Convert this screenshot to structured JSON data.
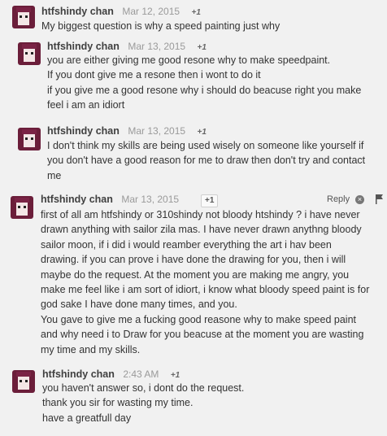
{
  "comments": [
    {
      "author": "htfshindy chan",
      "date": "Mar 12, 2015",
      "plus": "+1",
      "lines": [
        "My biggest question is why a speed painting just why"
      ]
    },
    {
      "author": "htfshindy chan",
      "date": "Mar 13, 2015",
      "plus": "+1",
      "lines": [
        "you are either giving me good resone why to make speedpaint.",
        "If you dont give me a resone then i wont to do it",
        "if you give me a good resone why i should do beacuse right you make",
        "feel i am an idiort"
      ]
    },
    {
      "author": "htfshindy chan",
      "date": "Mar 13, 2015",
      "plus": "+1",
      "lines": [
        "I don't think my skills are being used wisely on someone like yourself if",
        "you don't have a good reason for me to draw then don't try and contact",
        "me"
      ]
    },
    {
      "author": "htfshindy chan",
      "date": "Mar 13, 2015",
      "plus": "+1",
      "reply_label": "Reply",
      "lines": [
        "first of all  am htfshindy or 310shindy not bloody htshindy ? i have never",
        "drawn anything with sailor zila mas. I have never drawn anythng bloody",
        "sailor moon, if i did i would reamber everything  the art i hav been",
        "drawing. if you can prove i have done the  drawing for you, then i will",
        "maybe do the request. At the moment you are making me  angry, you",
        "make me feel like i am sort of idiort, i know what bloody speed paint is for",
        "god sake I have done many times, and you.",
        "You gave to give me a fucking good reasone why to make speed paint",
        "and why need i to Draw for you beacuse at the moment you are wasting",
        "my time and my skills."
      ]
    },
    {
      "author": "htfshindy chan",
      "date": "2:43 AM",
      "plus": "+1",
      "lines": [
        "you haven't answer so, i dont do the request.",
        "thank you sir for wasting my time.",
        "have a greatfull day"
      ]
    }
  ],
  "icons": {
    "avatar": "anime-avatar",
    "close": "close-icon",
    "flag": "flag-icon"
  },
  "colors": {
    "background": "#f1f1f1",
    "author": "#404040",
    "date": "#9a9a9a",
    "text": "#333333"
  }
}
